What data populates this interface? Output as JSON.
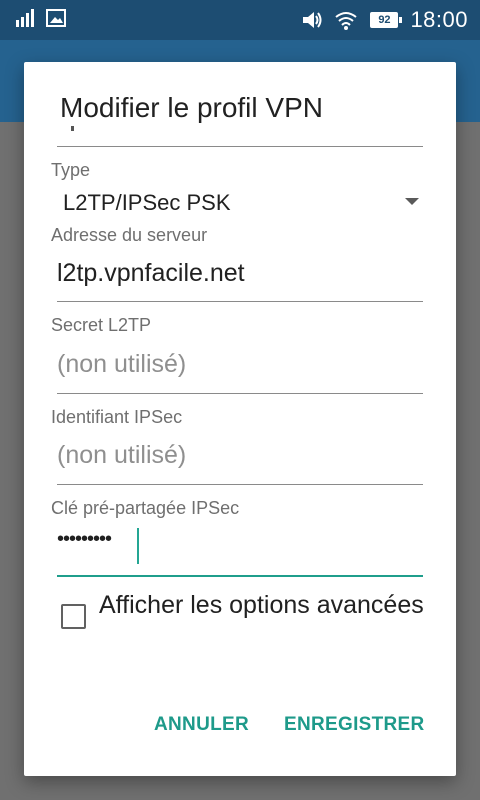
{
  "status_bar": {
    "time": "18:00",
    "battery": "92",
    "icons": [
      "signal-icon",
      "image-notification-icon",
      "volume-icon",
      "wifi-icon",
      "battery-icon"
    ]
  },
  "dialog": {
    "title": "Modifier le profil VPN",
    "type": {
      "label": "Type",
      "value": "L2TP/IPSec PSK"
    },
    "server_address": {
      "label": "Adresse du serveur",
      "value": "l2tp.vpnfacile.net"
    },
    "l2tp_secret": {
      "label": "Secret L2TP",
      "placeholder": "(non utilisé)"
    },
    "ipsec_identifier": {
      "label": "Identifiant IPSec",
      "placeholder": "(non utilisé)"
    },
    "ipsec_psk": {
      "label": "Clé pré-partagée IPSec",
      "masked_value": "•••••••••"
    },
    "advanced_options": {
      "label": "Afficher les options avancées",
      "checked": false
    },
    "buttons": {
      "cancel": "ANNULER",
      "save": "ENREGISTRER"
    }
  },
  "colors": {
    "status_bar": "#1d4d72",
    "app_bar": "#25628f",
    "accent": "#1e9a8a",
    "scrim": "#707070"
  }
}
